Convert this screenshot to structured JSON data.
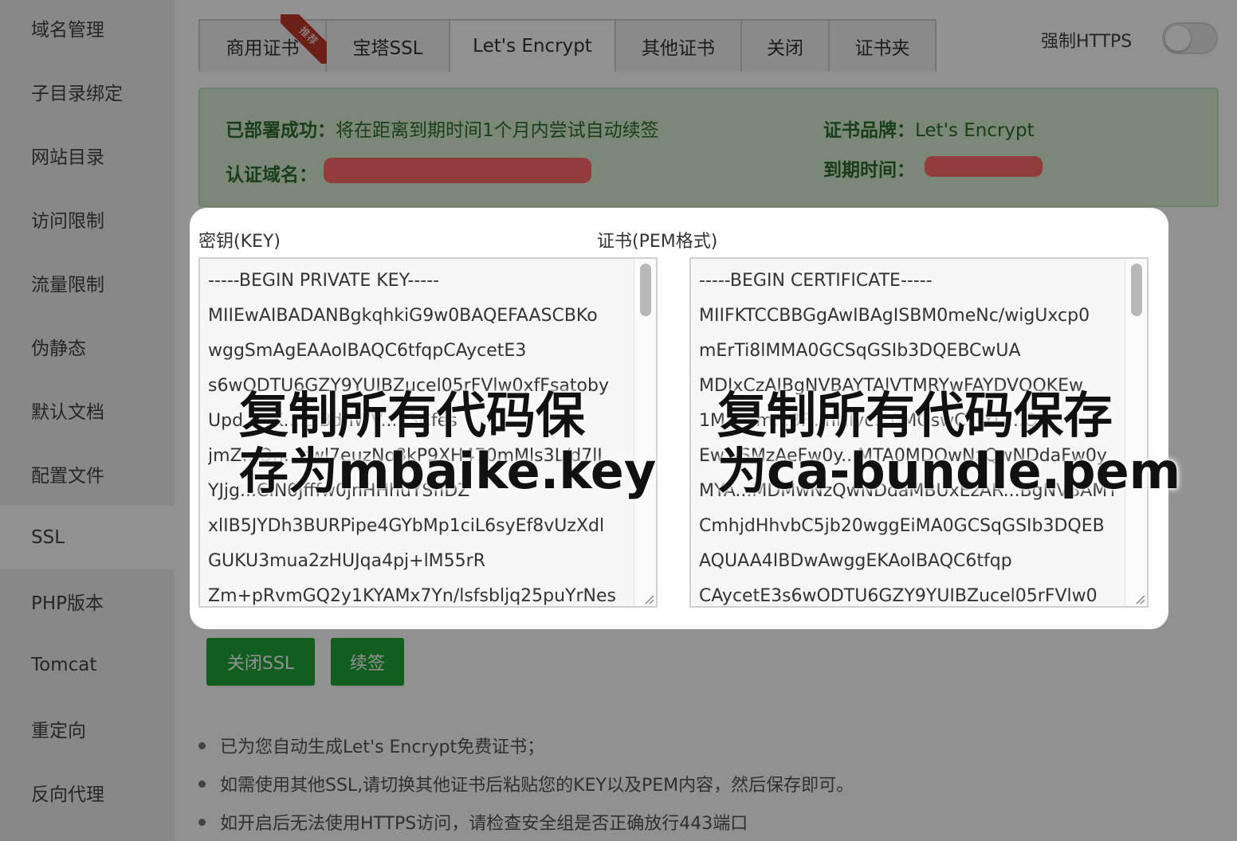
{
  "sidebar": {
    "items": [
      {
        "label": "域名管理"
      },
      {
        "label": "子目录绑定"
      },
      {
        "label": "网站目录"
      },
      {
        "label": "访问限制"
      },
      {
        "label": "流量限制"
      },
      {
        "label": "伪静态"
      },
      {
        "label": "默认文档"
      },
      {
        "label": "配置文件"
      },
      {
        "label": "SSL",
        "active": true
      },
      {
        "label": "PHP版本"
      },
      {
        "label": "Tomcat"
      },
      {
        "label": "重定向"
      },
      {
        "label": "反向代理"
      }
    ]
  },
  "tabs": [
    {
      "label": "商用证书",
      "ribbon": "推荐"
    },
    {
      "label": "宝塔SSL"
    },
    {
      "label": "Let's Encrypt",
      "active": true
    },
    {
      "label": "其他证书"
    },
    {
      "label": "关闭"
    },
    {
      "label": "证书夹"
    }
  ],
  "https": {
    "label": "强制HTTPS",
    "enabled": false
  },
  "status": {
    "deployed_key": "已部署成功：",
    "deployed_value": "将在距离到期时间1个月内尝试自动续签",
    "brand_key": "证书品牌：",
    "brand_value": "Let's Encrypt",
    "domain_key": "认证域名：",
    "expiry_key": "到期时间："
  },
  "key_panel": {
    "label": "密钥(KEY)",
    "lines": [
      "-----BEGIN PRIVATE KEY-----",
      "MIIEwAIBADANBgkqhkiG9w0BAQEFAASCBKo",
      "wggSmAgEAAoIBAQC6tfqpCAycetE3",
      "s6wODTU6GZY9YUIBZucel05rFVlw0xfFsatoby",
      "Upd...AK...ZrBdhWV...x3Cfes",
      "jmZ...Qn...cwl7euzNo8kP9XH470mMls3L/d7lJ",
      "YJjg...CIN0jfffw0jnHHhuYSflDZ",
      "xlIB5JYDh3BURPipe4GYbMp1ciL6syEf8vUzXdl",
      "GUKU3mua2zHUJqa4pj+lM55rR",
      "Zm+pRvmGQ2y1KYAMx7Yn/lsfsbljq25puYrNes"
    ],
    "overlay": [
      "复制所有代码保",
      "存为mbaike.key"
    ]
  },
  "cert_panel": {
    "label": "证书(PEM格式)",
    "lines": [
      "-----BEGIN CERTIFICATE-----",
      "MIIFKTCCBBGgAwIBAgISBM0meNc/wigUxcp0",
      "mErTi8lMMA0GCSqGSIb3DQEBCwUA",
      "MDIxCzAJBgNVBAYTAlVTMRYwFAYDVQQKEw",
      "1M...Qm...3F...nNlyc...0MQswC...YD...QD",
      "Ew...SMzAeFw0y...MTA0MDQwNzQwNDdaFw0y",
      "MYA...MDMwNzQwNDdaMBUxEzAR...BgNVBAMT",
      "CmhjdHhvbC5jb20wggEiMA0GCSqGSIb3DQEB",
      "AQUAA4IBDwAwggEKAoIBAQC6tfqp",
      "CAycetE3s6wODTU6GZY9YUIBZucel05rFVlw0"
    ],
    "overlay": [
      "复制所有代码保存",
      "为ca-bundle.pem"
    ]
  },
  "buttons": {
    "close_ssl": "关闭SSL",
    "renew": "续签"
  },
  "notes": [
    "已为您自动生成Let's Encrypt免费证书；",
    "如需使用其他SSL,请切换其他证书后粘贴您的KEY以及PEM内容，然后保存即可。",
    "如开启后无法使用HTTPS访问，请检查安全组是否正确放行443端口"
  ],
  "colors": {
    "accent_green": "#20a53a",
    "status_bg": "#d8f0d3",
    "redaction": "#ff6b6b",
    "ribbon": "#c0392b"
  }
}
